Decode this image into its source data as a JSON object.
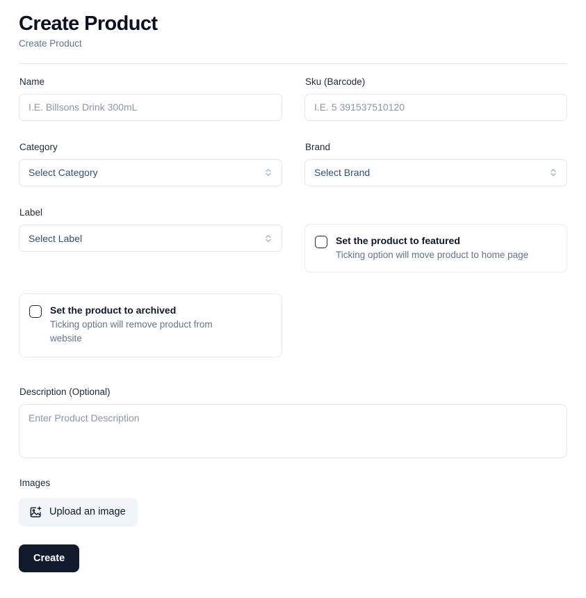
{
  "header": {
    "title": "Create Product",
    "subtitle": "Create Product"
  },
  "form": {
    "name": {
      "label": "Name",
      "placeholder": "I.E. Billsons Drink 300mL",
      "value": ""
    },
    "sku": {
      "label": "Sku (Barcode)",
      "placeholder": "I.E. 5 391537510120",
      "value": ""
    },
    "category": {
      "label": "Category",
      "selected": "Select Category",
      "icon": "chevron-up-down-icon"
    },
    "brand": {
      "label": "Brand",
      "selected": "Select Brand",
      "icon": "chevron-up-down-icon"
    },
    "label_field": {
      "label": "Label",
      "selected": "Select Label",
      "icon": "chevron-up-down-icon"
    },
    "featured": {
      "title": "Set the product to featured",
      "description": "Ticking option will move product to home page",
      "checked": false
    },
    "archived": {
      "title": "Set the product to archived",
      "description": "Ticking option will remove product from website",
      "checked": false
    },
    "description": {
      "label": "Description (Optional)",
      "placeholder": "Enter Product Description",
      "value": ""
    },
    "images": {
      "label": "Images",
      "upload_label": "Upload an image",
      "upload_icon": "image-plus-icon"
    },
    "submit_label": "Create"
  },
  "colors": {
    "accent": "#111a2e",
    "border": "#e2e8f0",
    "placeholder": "#8b96a5",
    "muted": "#64748b",
    "upload_bg": "#f1f5f9"
  }
}
